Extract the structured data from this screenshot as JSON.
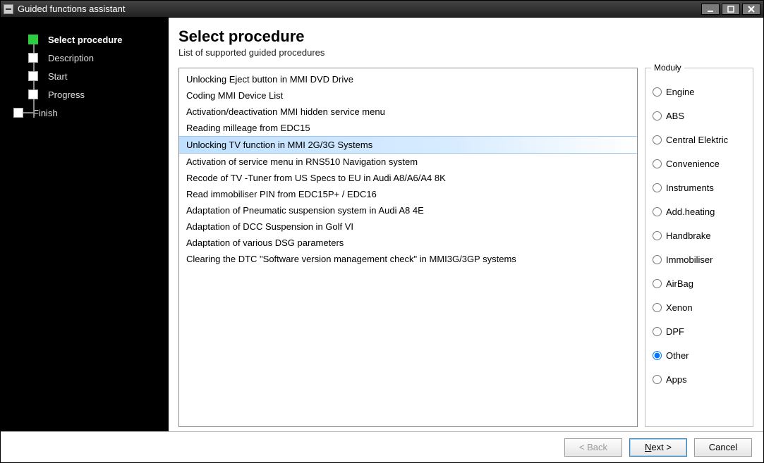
{
  "window": {
    "title": "Guided functions assistant"
  },
  "sidebar": {
    "steps": [
      {
        "label": "Select procedure",
        "active": true
      },
      {
        "label": "Description",
        "active": false
      },
      {
        "label": "Start",
        "active": false
      },
      {
        "label": "Progress",
        "active": false
      },
      {
        "label": "Finish",
        "active": false
      }
    ]
  },
  "main": {
    "title": "Select procedure",
    "subtitle": "List of supported guided procedures"
  },
  "procedures": [
    "Unlocking Eject button in MMI DVD Drive",
    "Coding MMI Device List",
    "Activation/deactivation MMI hidden service menu",
    "Reading milleage from EDC15",
    "Unlocking TV function in MMI 2G/3G Systems",
    "Activation of service menu in RNS510 Navigation system",
    "Recode of TV -Tuner from US Specs to EU in Audi A8/A6/A4 8K",
    "Read immobiliser PIN from EDC15P+ / EDC16",
    "Adaptation of Pneumatic suspension system in Audi A8 4E",
    "Adaptation of DCC Suspension in Golf VI",
    "Adaptation of various DSG parameters",
    "Clearing the DTC \"Software version management check\" in MMI3G/3GP systems"
  ],
  "procedures_selected_index": 4,
  "modules": {
    "legend": "Moduły",
    "options": [
      "Engine",
      "ABS",
      "Central Elektric",
      "Convenience",
      "Instruments",
      "Add.heating",
      "Handbrake",
      "Immobiliser",
      "AirBag",
      "Xenon",
      "DPF",
      "Other",
      "Apps"
    ],
    "selected_index": 11
  },
  "footer": {
    "back": "< Back",
    "next": "Next >",
    "next_mnemonic": "N",
    "cancel": "Cancel",
    "back_enabled": false
  }
}
